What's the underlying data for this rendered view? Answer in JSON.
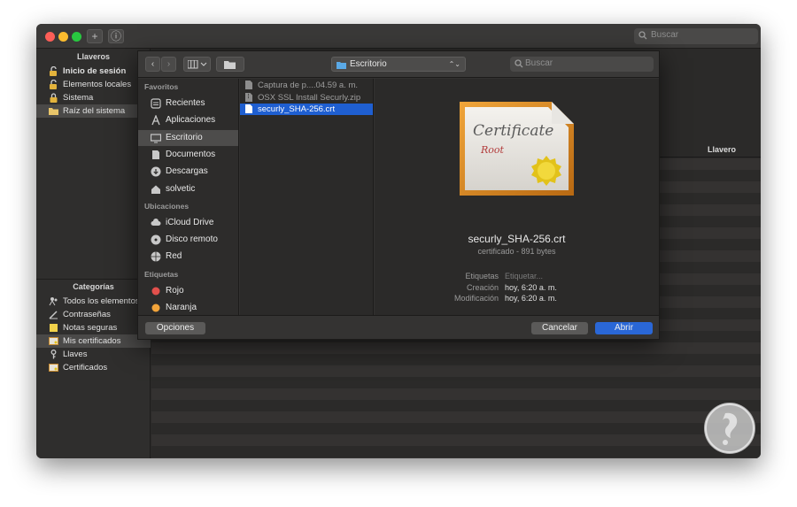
{
  "keychain": {
    "search_placeholder": "Buscar",
    "add_label": "+",
    "info_label": "ⓘ",
    "keychains_header": "Llaveros",
    "keychains": [
      {
        "label": "Inicio de sesión",
        "icon": "lock-open-icon",
        "bold": true
      },
      {
        "label": "Elementos locales",
        "icon": "lock-open-icon"
      },
      {
        "label": "Sistema",
        "icon": "lock-icon"
      },
      {
        "label": "Raíz del sistema",
        "icon": "folder-icon",
        "selected": true
      }
    ],
    "categories_header": "Categorías",
    "categories": [
      {
        "label": "Todos los elementos",
        "icon": "people-icon"
      },
      {
        "label": "Contraseñas",
        "icon": "pencil-icon"
      },
      {
        "label": "Notas seguras",
        "icon": "note-icon"
      },
      {
        "label": "Mis certificados",
        "icon": "certificate-icon",
        "selected": true
      },
      {
        "label": "Llaves",
        "icon": "key-icon"
      },
      {
        "label": "Certificados",
        "icon": "certificate-icon"
      }
    ],
    "column_header": "Llavero"
  },
  "dialog": {
    "location": "Escritorio",
    "search_placeholder": "Buscar",
    "favorites_header": "Favoritos",
    "favorites": [
      {
        "label": "Recientes",
        "icon": "clock-icon"
      },
      {
        "label": "Aplicaciones",
        "icon": "apps-icon"
      },
      {
        "label": "Escritorio",
        "icon": "desktop-icon",
        "selected": true
      },
      {
        "label": "Documentos",
        "icon": "document-icon"
      },
      {
        "label": "Descargas",
        "icon": "download-icon"
      },
      {
        "label": "solvetic",
        "icon": "home-icon"
      }
    ],
    "locations_header": "Ubicaciones",
    "locations": [
      {
        "label": "iCloud Drive",
        "icon": "cloud-icon"
      },
      {
        "label": "Disco remoto",
        "icon": "disc-icon"
      },
      {
        "label": "Red",
        "icon": "globe-icon"
      }
    ],
    "tags_header": "Etiquetas",
    "tags": [
      {
        "label": "Rojo",
        "color": "#e2504c"
      },
      {
        "label": "Naranja",
        "color": "#f2a43a"
      }
    ],
    "files": [
      {
        "label": "Captura de p....04.59 a. m.",
        "icon": "image-file-icon"
      },
      {
        "label": "OSX SSL Install Securly.zip",
        "icon": "zip-file-icon"
      },
      {
        "label": "securly_SHA-256.crt",
        "icon": "file-icon",
        "selected": true
      }
    ],
    "preview": {
      "cert_title": "Certificate",
      "cert_sub": "Root",
      "filename": "securly_SHA-256.crt",
      "subtitle": "certificado - 891 bytes",
      "meta": [
        {
          "key": "Etiquetas",
          "value": "Etiquetar...",
          "placeholder": true
        },
        {
          "key": "Creación",
          "value": "hoy, 6:20 a. m."
        },
        {
          "key": "Modificación",
          "value": "hoy, 6:20 a. m."
        }
      ]
    },
    "options_label": "Opciones",
    "cancel_label": "Cancelar",
    "open_label": "Abrir"
  },
  "colors": {
    "accent": "#1f5fd1",
    "primary_button": "#2a67d6"
  }
}
